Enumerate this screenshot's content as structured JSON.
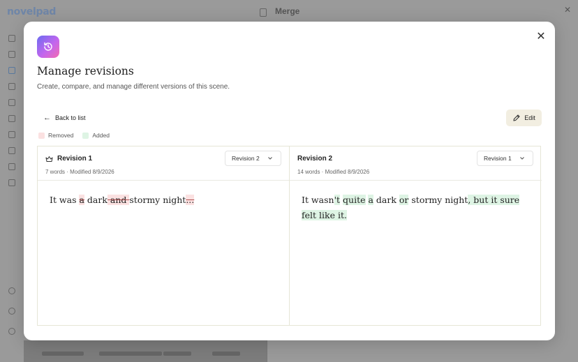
{
  "background": {
    "logo": "novelpad",
    "header_title": "Merge"
  },
  "modal": {
    "title": "Manage revisions",
    "subtitle": "Create, compare, and manage different versions of this scene.",
    "back_label": "Back to list",
    "edit_label": "Edit",
    "legend": {
      "removed": "Removed",
      "added": "Added"
    },
    "colors": {
      "removed": "#fbe1e1",
      "added": "#def4e4",
      "icon_gradient_start": "#6b6cf0",
      "icon_gradient_end": "#f36ab1"
    }
  },
  "left": {
    "title": "Revision 1",
    "meta": "7 words · Modified 8/9/2026",
    "select_value": "Revision 2",
    "segments": [
      {
        "text": "It was ",
        "type": "same"
      },
      {
        "text": "a",
        "type": "removed"
      },
      {
        "text": " dark",
        "type": "same"
      },
      {
        "text": " and ",
        "type": "removed"
      },
      {
        "text": "stormy night",
        "type": "same"
      },
      {
        "text": "...",
        "type": "removed"
      }
    ]
  },
  "right": {
    "title": "Revision 2",
    "meta": "14 words · Modified 8/9/2026",
    "select_value": "Revision 1",
    "segments": [
      {
        "text": "It wasn",
        "type": "same"
      },
      {
        "text": "'t",
        "type": "added"
      },
      {
        "text": " ",
        "type": "same"
      },
      {
        "text": "quite",
        "type": "added"
      },
      {
        "text": " ",
        "type": "same"
      },
      {
        "text": "a",
        "type": "added"
      },
      {
        "text": " dark ",
        "type": "same"
      },
      {
        "text": "or",
        "type": "added"
      },
      {
        "text": " stormy night",
        "type": "same"
      },
      {
        "text": ", but it sure felt like it.",
        "type": "added"
      }
    ]
  }
}
